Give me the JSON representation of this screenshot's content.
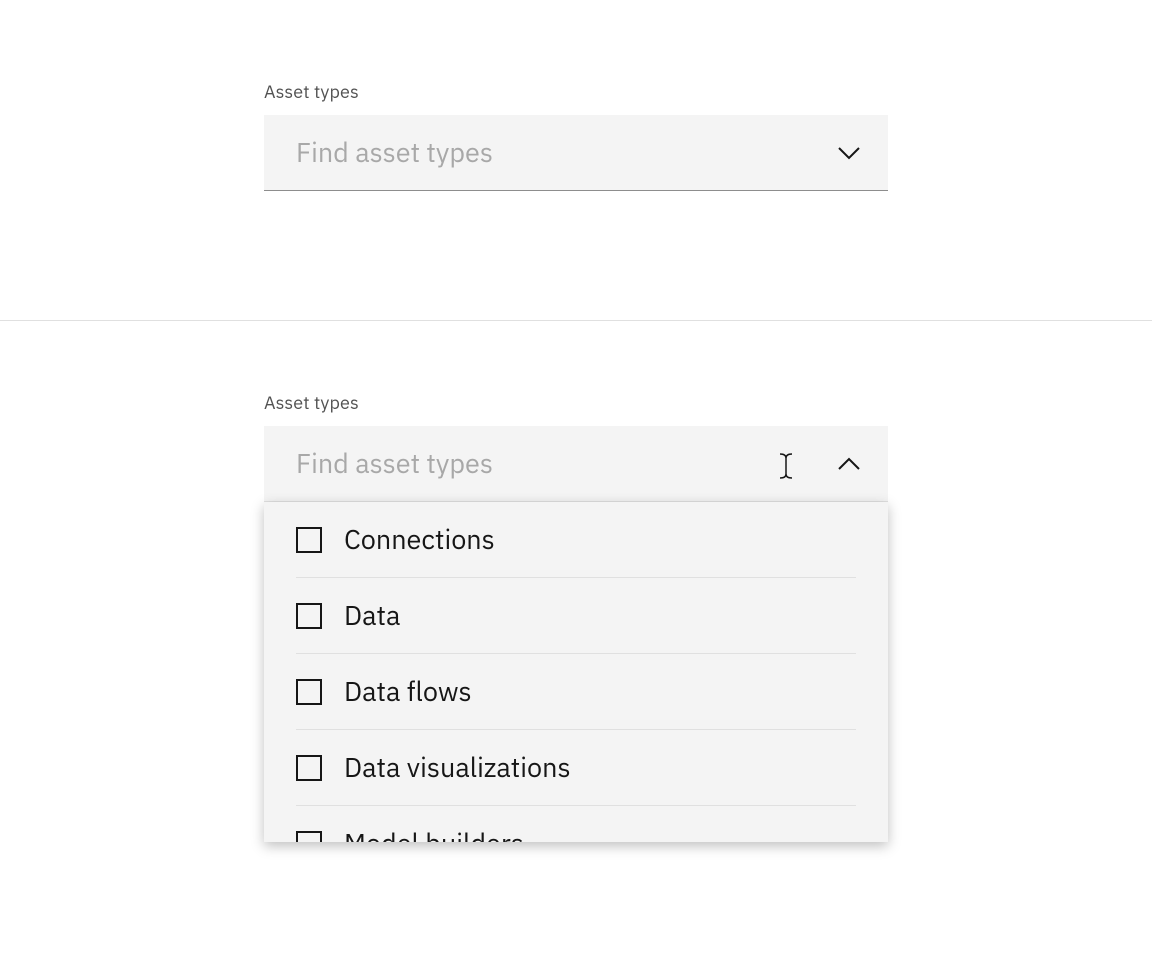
{
  "closed": {
    "label": "Asset types",
    "placeholder": "Find asset types"
  },
  "open": {
    "label": "Asset types",
    "placeholder": "Find asset types",
    "options": [
      {
        "label": "Connections",
        "checked": false
      },
      {
        "label": "Data",
        "checked": false
      },
      {
        "label": "Data flows",
        "checked": false
      },
      {
        "label": "Data visualizations",
        "checked": false
      },
      {
        "label": "Model builders",
        "checked": false
      }
    ]
  }
}
